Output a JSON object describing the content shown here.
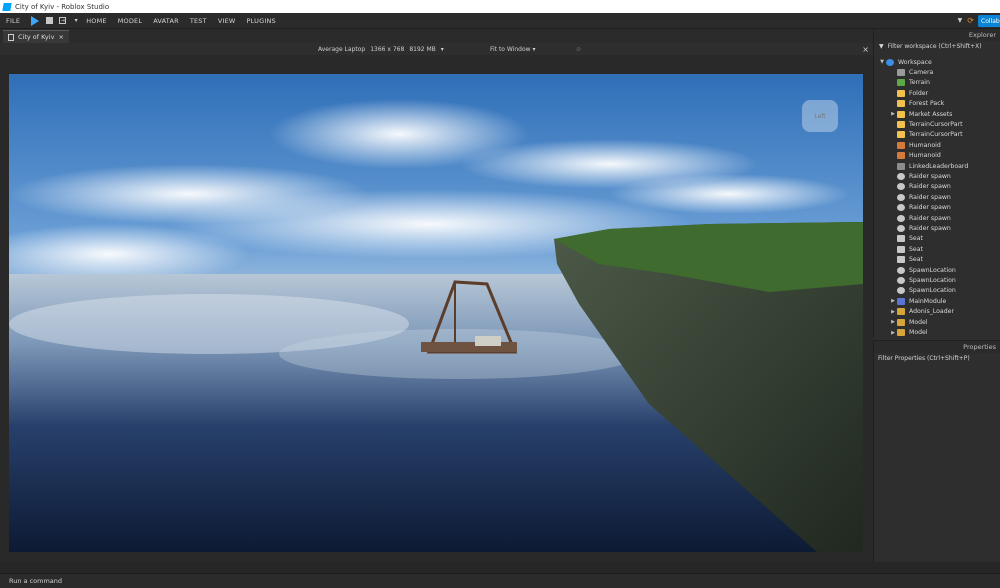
{
  "window": {
    "title": "City of Kyiv - Roblox Studio"
  },
  "menubar": {
    "file": "FILE",
    "items": [
      "HOME",
      "MODEL",
      "AVATAR",
      "TEST",
      "VIEW",
      "PLUGINS"
    ],
    "collaborate": "Collab"
  },
  "tab": {
    "label": "City of Kyiv",
    "close": "×"
  },
  "viewport_bar": {
    "device": "Average Laptop",
    "resolution": "1366 x 768",
    "memory": "8192 MB",
    "fit": "Fit to Window",
    "close": "×"
  },
  "viewport": {
    "view_cube_label": "Left"
  },
  "explorer": {
    "title": "Explorer",
    "filter": "Filter workspace (Ctrl+Shift+X)",
    "items": [
      {
        "label": "Workspace",
        "icon": "workspace-icon",
        "depth": 0,
        "expand": "▼"
      },
      {
        "label": "Camera",
        "icon": "camera-icon",
        "depth": 1,
        "expand": ""
      },
      {
        "label": "Terrain",
        "icon": "terrain-icon",
        "depth": 1,
        "expand": ""
      },
      {
        "label": "Folder",
        "icon": "folder-icon",
        "depth": 1,
        "expand": ""
      },
      {
        "label": "Forest Pack",
        "icon": "folder-icon",
        "depth": 1,
        "expand": ""
      },
      {
        "label": "Market Assets",
        "icon": "folder-icon",
        "depth": 1,
        "expand": "▶"
      },
      {
        "label": "TerrainCursorPart",
        "icon": "folder-icon",
        "depth": 1,
        "expand": ""
      },
      {
        "label": "TerrainCursorPart",
        "icon": "folder-icon",
        "depth": 1,
        "expand": ""
      },
      {
        "label": "Humanoid",
        "icon": "humanoid-icon",
        "depth": 1,
        "expand": ""
      },
      {
        "label": "Humanoid",
        "icon": "humanoid-icon",
        "depth": 1,
        "expand": ""
      },
      {
        "label": "LinkedLeaderboard",
        "icon": "script-icon",
        "depth": 1,
        "expand": ""
      },
      {
        "label": "Raider spawn",
        "icon": "gear-icon",
        "depth": 1,
        "expand": ""
      },
      {
        "label": "Raider spawn",
        "icon": "gear-icon",
        "depth": 1,
        "expand": ""
      },
      {
        "label": "Raider spawn",
        "icon": "gear-icon",
        "depth": 1,
        "expand": ""
      },
      {
        "label": "Raider spawn",
        "icon": "gear-icon",
        "depth": 1,
        "expand": ""
      },
      {
        "label": "Raider spawn",
        "icon": "gear-icon",
        "depth": 1,
        "expand": ""
      },
      {
        "label": "Raider spawn",
        "icon": "gear-icon",
        "depth": 1,
        "expand": ""
      },
      {
        "label": "Seat",
        "icon": "seat-icon",
        "depth": 1,
        "expand": ""
      },
      {
        "label": "Seat",
        "icon": "seat-icon",
        "depth": 1,
        "expand": ""
      },
      {
        "label": "Seat",
        "icon": "seat-icon",
        "depth": 1,
        "expand": ""
      },
      {
        "label": "SpawnLocation",
        "icon": "gear-icon",
        "depth": 1,
        "expand": ""
      },
      {
        "label": "SpawnLocation",
        "icon": "gear-icon",
        "depth": 1,
        "expand": ""
      },
      {
        "label": "SpawnLocation",
        "icon": "gear-icon",
        "depth": 1,
        "expand": ""
      },
      {
        "label": "MainModule",
        "icon": "module-icon",
        "depth": 1,
        "expand": "▶"
      },
      {
        "label": "Adonis_Loader",
        "icon": "model-icon",
        "depth": 1,
        "expand": "▶"
      },
      {
        "label": "Model",
        "icon": "model-icon",
        "depth": 1,
        "expand": "▶"
      },
      {
        "label": "Model",
        "icon": "model-icon",
        "depth": 1,
        "expand": "▶"
      }
    ]
  },
  "properties": {
    "title": "Properties",
    "filter": "Filter Properties (Ctrl+Shift+P)"
  },
  "command_bar": {
    "placeholder": "Run a command"
  },
  "colors": {
    "accent": "#0a84d6",
    "panel_bg": "#2e2e2e",
    "play": "#3ba7ff",
    "folder": "#f2c14e"
  }
}
